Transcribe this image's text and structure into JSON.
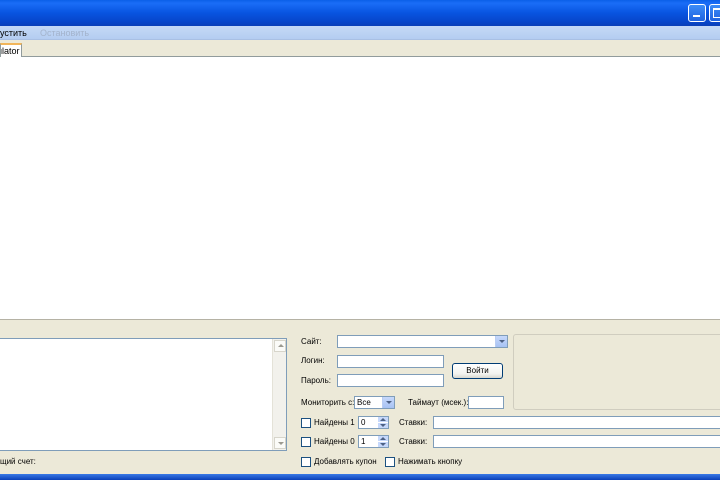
{
  "menu": {
    "start_label": "устить",
    "stop_label": "Остановить"
  },
  "tabs": [
    {
      "label": "ulator"
    }
  ],
  "log": {
    "text": ""
  },
  "balance": {
    "label": "щий счет:"
  },
  "form": {
    "site_label": "Сайт:",
    "site_value": "",
    "login_label": "Логин:",
    "login_value": "",
    "password_label": "Пароль:",
    "password_value": "",
    "login_button": "Войти",
    "monitor_label": "Мониторить с:",
    "monitor_value": "Все",
    "timeout_label": "Таймаут (мсек.):",
    "timeout_value": "",
    "found1_label": "Найдены 1",
    "found1_value": "0",
    "bets1_label": "Ставки:",
    "bets1_value": "",
    "found0_label": "Найдены 0",
    "found0_value": "1",
    "bets2_label": "Ставки:",
    "bets2_value": "",
    "add_coupon_label": "Добавлять купон",
    "press_button_label": "Нажимать кнопку"
  },
  "colors": {
    "titlebar": "#0854e0",
    "menubar": "#c5d9f6",
    "panel": "#ece9d8",
    "tab_accent": "#f1b55a"
  }
}
